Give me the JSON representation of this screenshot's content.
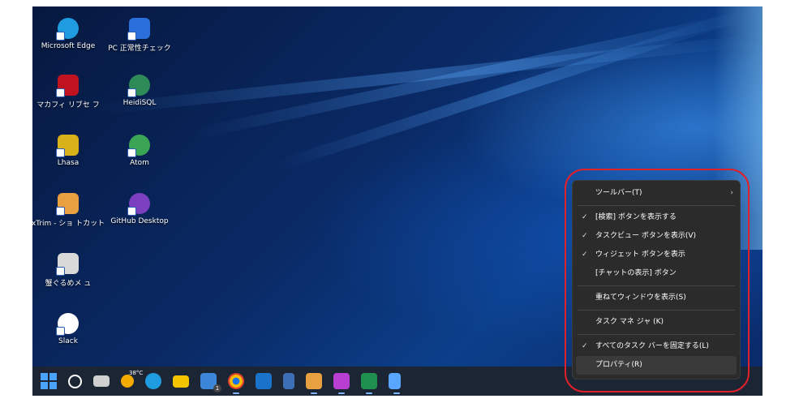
{
  "desktop_icons": [
    {
      "label": "Microsoft Edge",
      "icon": "edge-icon",
      "color": "#1f9be0"
    },
    {
      "label": "PC 正常性チェック",
      "icon": "pc-health-icon",
      "color": "#2a6fdb"
    },
    {
      "label": "マカフィ リブセ フ",
      "icon": "mcafee-icon",
      "color": "#c1121f"
    },
    {
      "label": "HeidiSQL",
      "icon": "heidisql-icon",
      "color": "#2e8b57"
    },
    {
      "label": "Lhasa",
      "icon": "lhasa-icon",
      "color": "#d9b21a"
    },
    {
      "label": "Atom",
      "icon": "atom-icon",
      "color": "#3aa655"
    },
    {
      "label": "xTrim - ショ トカット",
      "icon": "xtrim-icon",
      "color": "#e8a040"
    },
    {
      "label": "GitHub Desktop",
      "icon": "github-desktop-icon",
      "color": "#7b3fbf"
    },
    {
      "label": "蟹ぐるめメ ュ",
      "icon": "menu-app-icon",
      "color": "#d9d9d9"
    },
    {
      "label": "Slack",
      "icon": "slack-icon",
      "color": "#e01e5a"
    }
  ],
  "taskbar": {
    "weather_temp": "38°C",
    "mail_badge": "1",
    "items": [
      {
        "name": "start-icon",
        "color": "#4aa3ff"
      },
      {
        "name": "search-icon",
        "color": "#ffffff"
      },
      {
        "name": "task-view-icon",
        "color": "#d0d0d0"
      },
      {
        "name": "weather-icon",
        "color": "#f2a900"
      },
      {
        "name": "edge-taskbar-icon",
        "color": "#1f9be0"
      },
      {
        "name": "file-explorer-icon",
        "color": "#f5c400"
      },
      {
        "name": "mail-icon",
        "color": "#3b86d8"
      },
      {
        "name": "chrome-icon",
        "color": "#e0442f"
      },
      {
        "name": "outlook-icon",
        "color": "#1a73c8"
      },
      {
        "name": "notes-icon",
        "color": "#3c6fb6"
      },
      {
        "name": "xtrim-taskbar-icon",
        "color": "#e8a040"
      },
      {
        "name": "snipping-tool-icon",
        "color": "#b83fd1"
      },
      {
        "name": "excel-icon",
        "color": "#1f8f4e"
      },
      {
        "name": "notepad-icon",
        "color": "#58a6ff"
      }
    ]
  },
  "context_menu": {
    "items": [
      {
        "label": "ツールバー(T)",
        "checked": false,
        "submenu": true
      },
      {
        "label": "[検索] ボタンを表示する",
        "checked": true
      },
      {
        "label": "タスクビュー ボタンを表示(V)",
        "checked": true
      },
      {
        "label": "ウィジェット ボタンを表示",
        "checked": true
      },
      {
        "label": "[チャットの表示] ボタン",
        "checked": false
      },
      {
        "label": "重ねてウィンドウを表示(S)",
        "checked": false
      },
      {
        "label": "タスク マネ ジャ (K)",
        "checked": false
      },
      {
        "label": "すべてのタスク バーを固定する(L)",
        "checked": true
      },
      {
        "label": "プロパティ(R)",
        "checked": false
      }
    ],
    "check_glyph": "✓",
    "submenu_glyph": "›"
  }
}
